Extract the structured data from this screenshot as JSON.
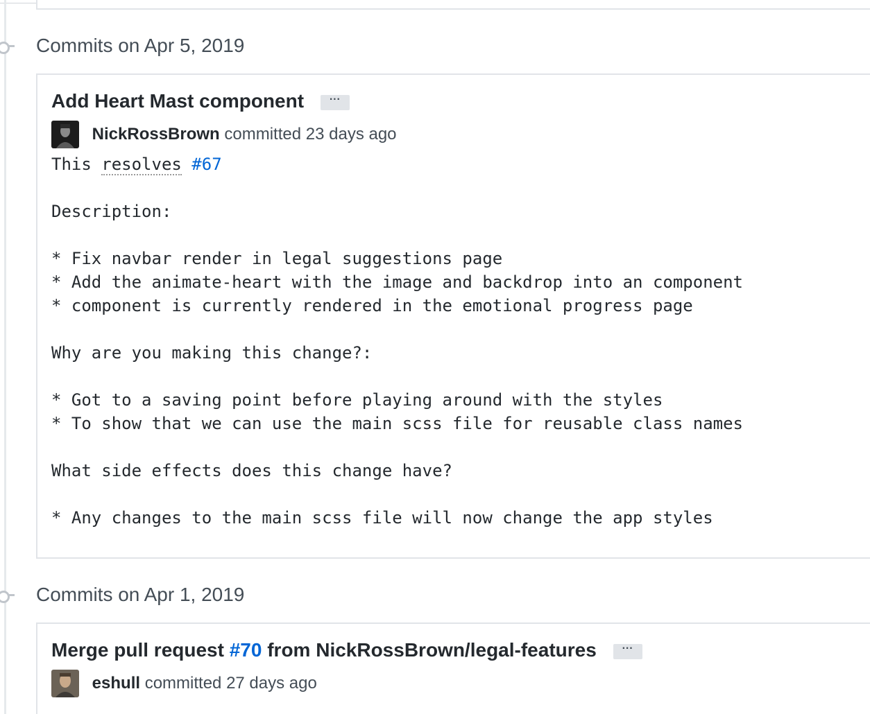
{
  "sections": [
    {
      "date_heading": "Commits on Apr 5, 2019",
      "commit": {
        "title": "Add Heart Mast component",
        "ellipsis": "···",
        "author": "NickRossBrown",
        "committed_text": "committed 23 days ago",
        "body": {
          "line1_prefix": "This ",
          "line1_resolves": "resolves",
          "line1_space": " ",
          "line1_issue": "#67",
          "rest": "\n\nDescription:\n\n* Fix navbar render in legal suggestions page\n* Add the animate-heart with the image and backdrop into an component\n* component is currently rendered in the emotional progress page\n\nWhy are you making this change?:\n\n* Got to a saving point before playing around with the styles\n* To show that we can use the main scss file for reusable class names\n\nWhat side effects does this change have?\n\n* Any changes to the main scss file will now change the app styles"
        }
      }
    },
    {
      "date_heading": "Commits on Apr 1, 2019",
      "commit": {
        "title_prefix": "Merge pull request ",
        "title_pr": "#70",
        "title_suffix": " from NickRossBrown/legal-features",
        "ellipsis": "···",
        "author": "eshull",
        "committed_text": "committed 27 days ago"
      }
    }
  ],
  "icons": {
    "timeline_node": "commit-node-icon",
    "avatar_1": "avatar",
    "avatar_2": "avatar"
  },
  "colors": {
    "link": "#0366d6",
    "border": "#e1e4e8",
    "text": "#24292e"
  }
}
